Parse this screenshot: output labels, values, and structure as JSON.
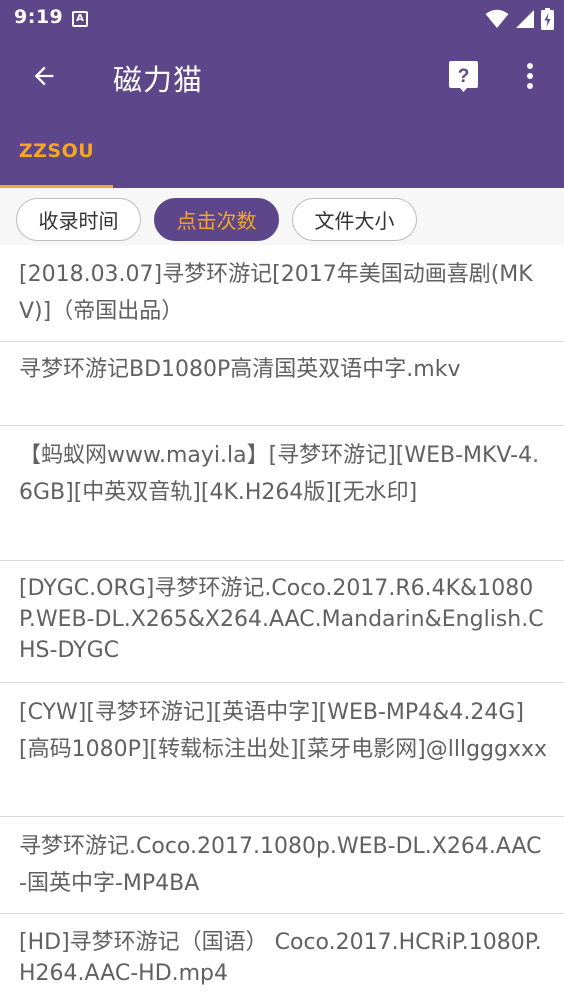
{
  "status_bar": {
    "time": "9:19",
    "notification_letter": "A",
    "icons": [
      "wifi-icon",
      "cell-signal-icon",
      "battery-icon"
    ]
  },
  "toolbar": {
    "title": "磁力猫",
    "back_icon": "arrow-left-icon",
    "help_icon": "help-icon",
    "more_icon": "more-vertical-icon"
  },
  "tabs": [
    {
      "label": "ZZSOU",
      "selected": true
    }
  ],
  "sort_chips": [
    {
      "label": "收录时间",
      "selected": false
    },
    {
      "label": "点击次数",
      "selected": true
    },
    {
      "label": "文件大小",
      "selected": false
    }
  ],
  "results": [
    "[2018.03.07]寻梦环游记[2017年美国动画喜剧(MKV)]（帝国出品）",
    "寻梦环游记BD1080P高清国英双语中字.mkv",
    "【蚂蚁网www.mayi.la】[寻梦环游记][WEB-MKV-4.6GB][中英双音轨][4K.H264版][无水印]",
    "[DYGC.ORG]寻梦环游记.Coco.2017.R6.4K&1080P.WEB-DL.X265&X264.AAC.Mandarin&English.CHS-DYGC",
    "[CYW][寻梦环游记][英语中字][WEB-MP4&4.24G][高码1080P][转载标注出处][菜牙电影网]@lllgggxxx",
    "寻梦环游记.Coco.2017.1080p.WEB-DL.X264.AAC-国英中字-MP4BA",
    "[HD]寻梦环游记（国语） Coco.2017.HCRiP.1080P.H264.AAC-HD.mp4"
  ],
  "colors": {
    "primary": "#5d4689",
    "accent": "#f5a623",
    "text": "#616161",
    "divider": "#dadada"
  }
}
